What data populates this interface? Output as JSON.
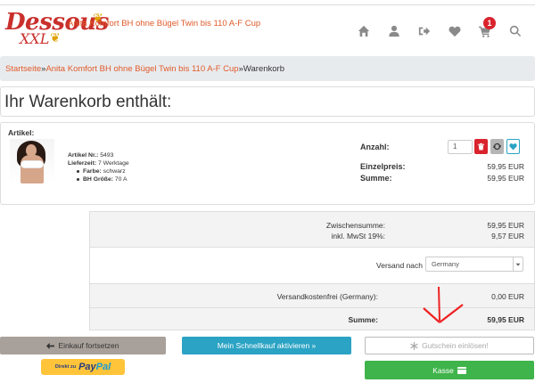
{
  "logo": {
    "line1": "Dessous",
    "line2": "XXL"
  },
  "header": {
    "icons": [
      "home-icon",
      "user-icon",
      "logout-icon",
      "heart-icon",
      "cart-icon",
      "search-icon"
    ],
    "cart_count": "1"
  },
  "breadcrumb": {
    "home": "Startseite",
    "sep1": "»",
    "product": "Anita Komfort BH ohne Bügel Twin bis 110 A-F Cup",
    "sep2": "»",
    "current": "Warenkorb"
  },
  "page_title": "Ihr Warenkorb enthält:",
  "cart": {
    "article_header": "Artikel:",
    "item": {
      "name": "Anita Komfort BH ohne Bügel Twin bis 110 A-F Cup",
      "article_no_label": "Artikel Nr.:",
      "article_no": "5493",
      "delivery_label": "Lieferzeit:",
      "delivery": "7 Werktage",
      "attributes": [
        {
          "label": "Farbe:",
          "value": "schwarz"
        },
        {
          "label": "BH Größe:",
          "value": "70 A"
        }
      ],
      "qty_label": "Anzahl:",
      "qty": "1",
      "unit_price_label": "Einzelpreis:",
      "unit_price": "59,95 EUR",
      "sum_label": "Summe:",
      "sum": "59,95 EUR"
    }
  },
  "summary": {
    "subtotal_label": "Zwischensumme:",
    "subtotal": "59,95 EUR",
    "vat_label": "inkl. MwSt 19%:",
    "vat": "9,57 EUR",
    "shipping_to_label": "Versand nach",
    "country": "Germany",
    "free_shipping_label": "Versandkostenfrei (Germany):",
    "free_shipping": "0,00 EUR",
    "total_label": "Summe:",
    "total": "59,95 EUR"
  },
  "buttons": {
    "back": "Einkauf fortsetzen",
    "quick": "Mein Schnellkauf aktivieren »",
    "voucher": "Gutschein einlösen!",
    "checkout": "Kasse",
    "paypal_small": "Direkt zu",
    "paypal_pay": "Pay",
    "paypal_pal": "Pal"
  },
  "colors": {
    "accent": "#e05a2a",
    "danger": "#d9232d",
    "info": "#2ba3c4",
    "success": "#3fb44a",
    "paypal": "#ffc43a"
  }
}
